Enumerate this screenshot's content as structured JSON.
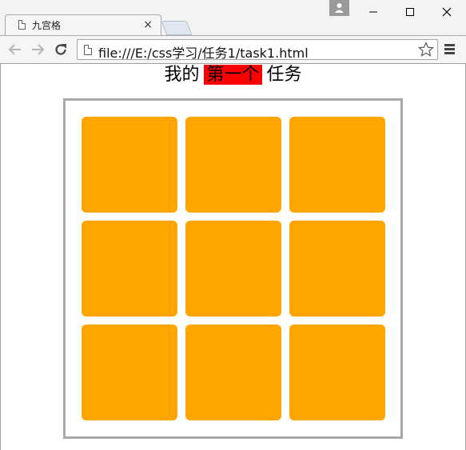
{
  "browser": {
    "tab_title": "九宫格",
    "tab_close": "×",
    "url": "file:///E:/css学习/任务1/task1.html"
  },
  "page": {
    "heading_before": "我的",
    "heading_highlight": "第一个",
    "heading_after": "任务",
    "highlight_color": "#ff0000",
    "cell_color": "#ffa500",
    "border_color": "#a9a9a9",
    "cell_count": 9
  }
}
